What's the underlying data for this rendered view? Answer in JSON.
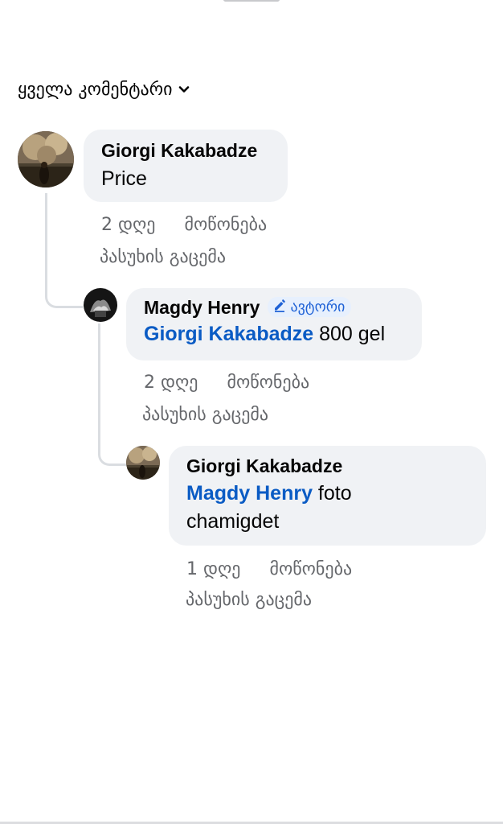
{
  "sort": {
    "label": "ყველა კომენტარი",
    "icon": "chevron-down-icon"
  },
  "comments": [
    {
      "author": "Giorgi Kakabadze",
      "text": "Price",
      "time": "2 დღე",
      "like": "მოწონება",
      "reply": "პასუხის გაცემა"
    },
    {
      "author": "Magdy Henry",
      "badge": "ავტორი",
      "badge_icon": "pencil-icon",
      "mention": "Giorgi Kakabadze",
      "text": " 800 gel",
      "time": "2 დღე",
      "like": "მოწონება",
      "reply": "პასუხის გაცემა"
    },
    {
      "author": "Giorgi Kakabadze",
      "mention": "Magdy Henry",
      "text_line1": " foto",
      "text_line2": "chamigdet",
      "time": "1 დღე",
      "like": "მოწონება",
      "reply": "პასუხის გაცემა"
    }
  ],
  "colors": {
    "bubble": "#f0f2f5",
    "mention": "#0a5bc4",
    "meta_text": "#65676b",
    "badge_bg": "#e7f0fd",
    "badge_text": "#1f62d6"
  }
}
